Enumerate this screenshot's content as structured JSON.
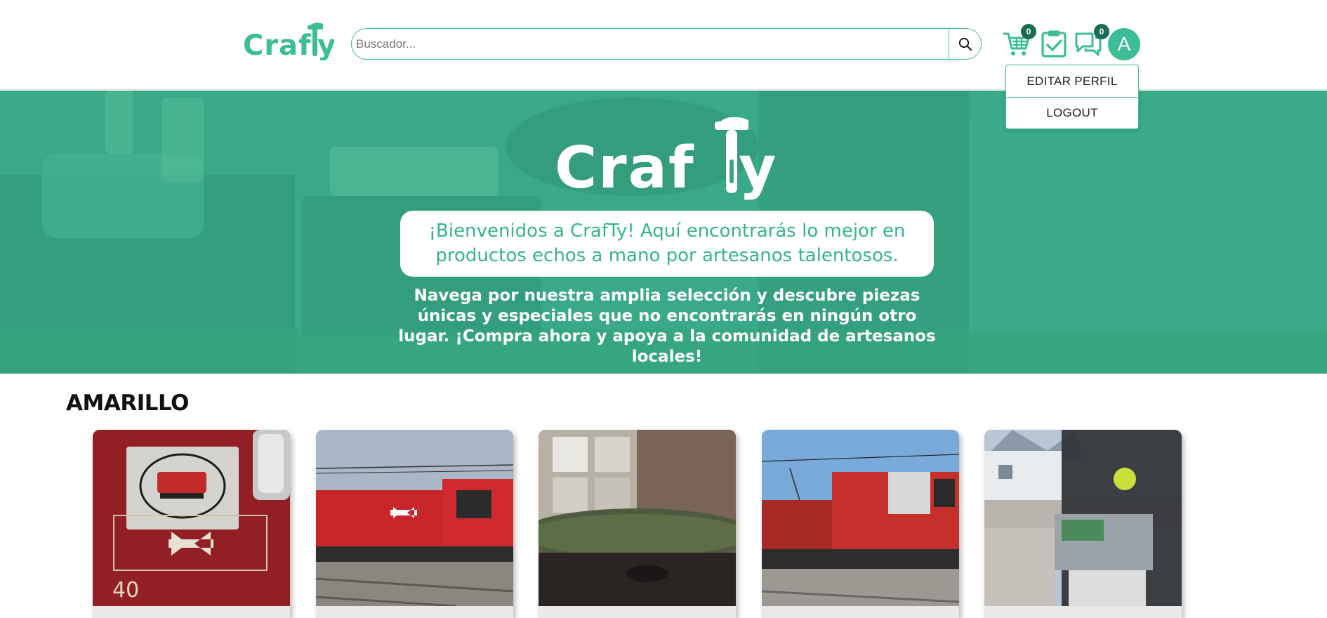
{
  "header": {
    "logo_text": "Crafty",
    "search": {
      "placeholder": "Buscador...",
      "value": ""
    },
    "cart": {
      "icon": "cart-icon",
      "count": "0"
    },
    "orders": {
      "icon": "clipboard-check-icon"
    },
    "messages": {
      "icon": "chat-icon",
      "count": "0"
    },
    "avatar_letter": "A",
    "menu": {
      "edit_profile": "EDITAR PERFIL",
      "logout": "LOGOUT"
    }
  },
  "hero": {
    "logo_text": "Crafty",
    "welcome": "¡Bienvenidos a CrafTy! Aquí encontrarás lo mejor en productos echos a mano por artesanos talentosos.",
    "description": "Navega por nuestra amplia selección y descubre piezas únicas y especiales que no encontrarás en ningún otro lugar. ¡Compra ahora y apoya a la comunidad de artesanos locales!"
  },
  "section": {
    "title": "AMARILLO",
    "products": [
      {
        "image": "red-train-sign-photo"
      },
      {
        "image": "red-train-container-photo"
      },
      {
        "image": "model-railway-photo"
      },
      {
        "image": "red-locomotive-photo"
      },
      {
        "image": "train-cab-controls-photo"
      }
    ]
  },
  "colors": {
    "accent": "#3cbd96",
    "badge": "#1b6b55",
    "hero_overlay": "#34b28c"
  }
}
